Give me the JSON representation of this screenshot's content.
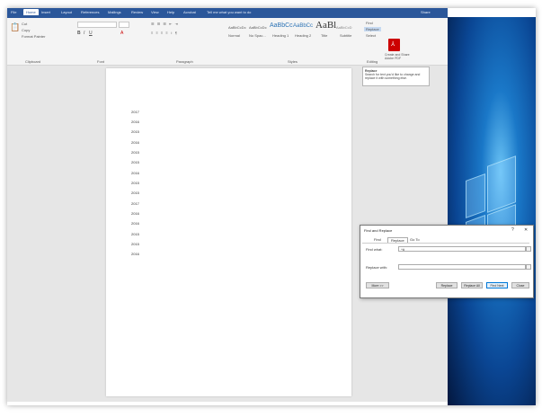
{
  "ribbon": {
    "tabs": [
      "File",
      "Home",
      "Insert",
      "Layout",
      "References",
      "Mailings",
      "Review",
      "View",
      "Help",
      "Acrobat",
      "Tell me what you want to do"
    ],
    "active_tab": "Home",
    "share": "Share",
    "groups": [
      "Clipboard",
      "Font",
      "Paragraph",
      "Styles",
      "Editing"
    ],
    "clipboard_items": [
      "Cut",
      "Copy",
      "Format Painter"
    ],
    "style_samples": [
      "AaBbCcDc",
      "AaBbCcDc",
      "AaBbCc",
      "AaBbCc",
      "AaBl",
      "AaBbCcD"
    ],
    "style_names": [
      "Normal",
      "No Spac...",
      "Heading 1",
      "Heading 2",
      "Title",
      "Subtitle"
    ],
    "editing_items": [
      "Find",
      "Replace",
      "Select"
    ],
    "acrobat_label": "Create and Share Adobe PDF"
  },
  "tooltip": {
    "title": "Replace",
    "body": "Search for text you'd like to change and replace it with something else."
  },
  "document": {
    "lines": [
      "2017",
      "2016",
      "2015",
      "2016",
      "2015",
      "2015",
      "2016",
      "2015",
      "2015",
      "2017",
      "2016",
      "2016",
      "2015",
      "2015",
      "2016"
    ]
  },
  "dialog": {
    "title": "Find and Replace",
    "help": "?",
    "close": "✕",
    "tabs": [
      "Find",
      "Replace",
      "Go To"
    ],
    "active_tab": "Replace",
    "find_label": "Find what:",
    "find_value": "^#",
    "replace_label": "Replace with:",
    "replace_value": "",
    "buttons": {
      "more": "More >>",
      "replace": "Replace",
      "replace_all": "Replace All",
      "find_next": "Find Next",
      "close": "Close"
    }
  }
}
